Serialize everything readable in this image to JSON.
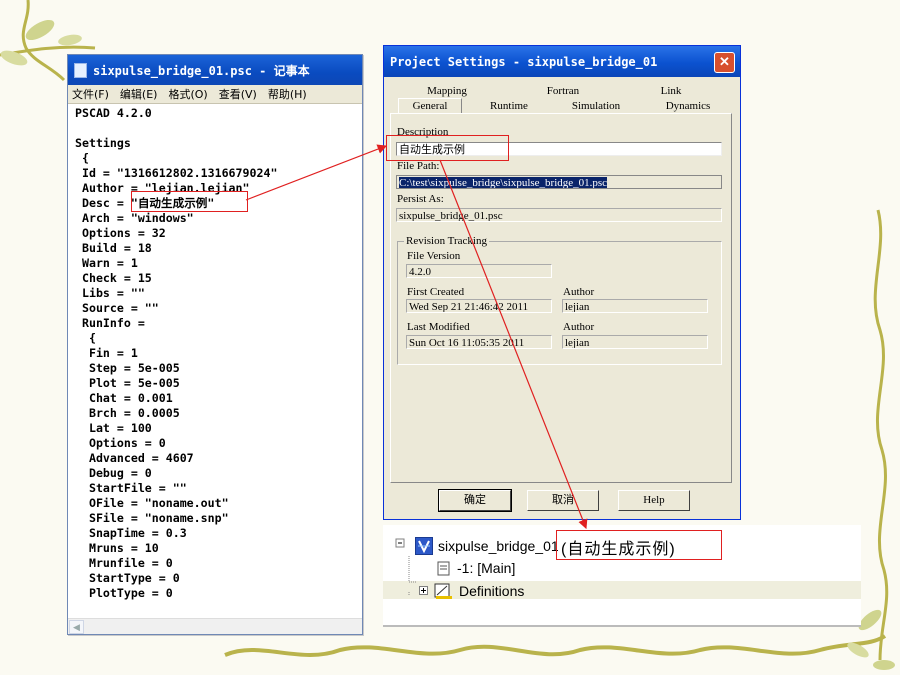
{
  "notepad": {
    "title": "sixpulse_bridge_01.psc - 记事本",
    "menu": [
      "文件(F)",
      "编辑(E)",
      "格式(O)",
      "查看(V)",
      "帮助(H)"
    ],
    "content": "PSCAD 4.2.0\n\nSettings\n {\n Id = \"1316612802.1316679024\"\n Author = \"lejian.lejian\"\n Desc = \"自动生成示例\"\n Arch = \"windows\"\n Options = 32\n Build = 18\n Warn = 1\n Check = 15\n Libs = \"\"\n Source = \"\"\n RunInfo =\n  {\n  Fin = 1\n  Step = 5e-005\n  Plot = 5e-005\n  Chat = 0.001\n  Brch = 0.0005\n  Lat = 100\n  Options = 0\n  Advanced = 4607\n  Debug = 0\n  StartFile = \"\"\n  OFile = \"noname.out\"\n  SFile = \"noname.snp\"\n  SnapTime = 0.3\n  Mruns = 10\n  Mrunfile = 0\n  StartType = 0\n  PlotType = 0"
  },
  "dialog": {
    "title": "Project Settings - sixpulse_bridge_01",
    "close": "✕",
    "tabs_back": [
      "Mapping",
      "Fortran",
      "Link"
    ],
    "tabs_front": [
      "General",
      "Runtime",
      "Simulation",
      "Dynamics"
    ],
    "description_label": "Description",
    "description_value": "自动生成示例",
    "filepath_label": "File Path:",
    "filepath_value": "C:\\test\\sixpulse_bridge\\sixpulse_bridge_01.psc",
    "persist_label": "Persist As:",
    "persist_value": "sixpulse_bridge_01.psc",
    "revision_label": "Revision Tracking",
    "file_version_label": "File Version",
    "file_version_value": "4.2.0",
    "first_created_label": "First Created",
    "first_created_value": "Wed Sep 21 21:46:42 2011",
    "author_label": "Author",
    "first_author_value": "lejian",
    "last_modified_label": "Last Modified",
    "last_modified_value": "Sun Oct 16 11:05:35 2011",
    "last_author_value": "lejian",
    "ok_label": "确定",
    "cancel_label": "取消",
    "help_label": "Help"
  },
  "tree": {
    "project_name": "sixpulse_bridge_01",
    "project_desc": "(自动生成示例)",
    "main_label": "-1: [Main]",
    "definitions_label": "Definitions"
  },
  "colors": {
    "highlight": "#e02020",
    "titlebar": "#0b52d0",
    "vine": "#b9b34c",
    "leaf": "#cfd48e"
  }
}
